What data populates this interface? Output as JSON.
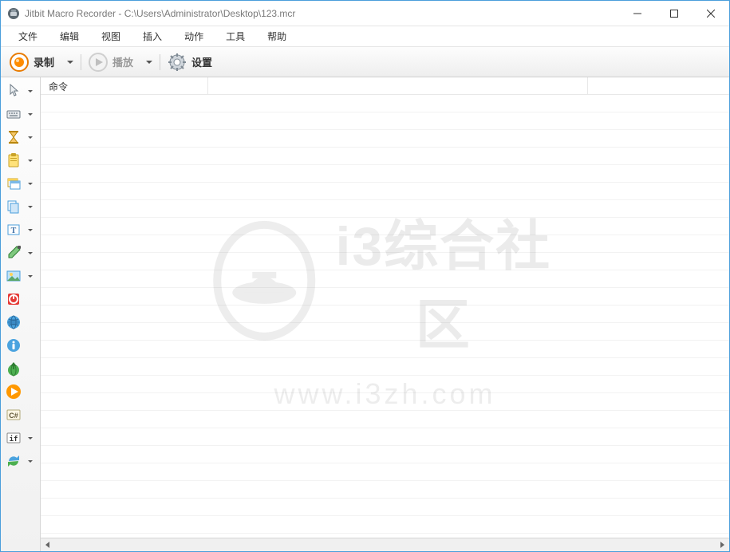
{
  "titlebar": {
    "title": "Jitbit Macro Recorder - C:\\Users\\Administrator\\Desktop\\123.mcr"
  },
  "menu": {
    "file": "文件",
    "edit": "编辑",
    "view": "视图",
    "insert": "插入",
    "action": "动作",
    "tools": "工具",
    "help": "帮助"
  },
  "toolbar": {
    "record": "录制",
    "play": "播放",
    "settings": "设置"
  },
  "grid": {
    "col1": "命令",
    "col2": "",
    "col3": ""
  },
  "sidebar_icons": {
    "mouse": "mouse-icon",
    "keyboard": "keyboard-icon",
    "delay": "hourglass-icon",
    "clipboard": "clipboard-icon",
    "window": "window-icon",
    "copy": "copy-icon",
    "text": "text-icon",
    "color": "eyedropper-icon",
    "image": "image-icon",
    "power": "power-icon",
    "web": "globe-icon",
    "info": "info-icon",
    "upload": "upload-globe-icon",
    "playmacro": "play-icon",
    "csharp": "csharp-icon",
    "if": "if-icon",
    "refresh": "refresh-icon"
  },
  "watermark": {
    "text": "i3综合社区",
    "url": "www.i3zh.com"
  }
}
